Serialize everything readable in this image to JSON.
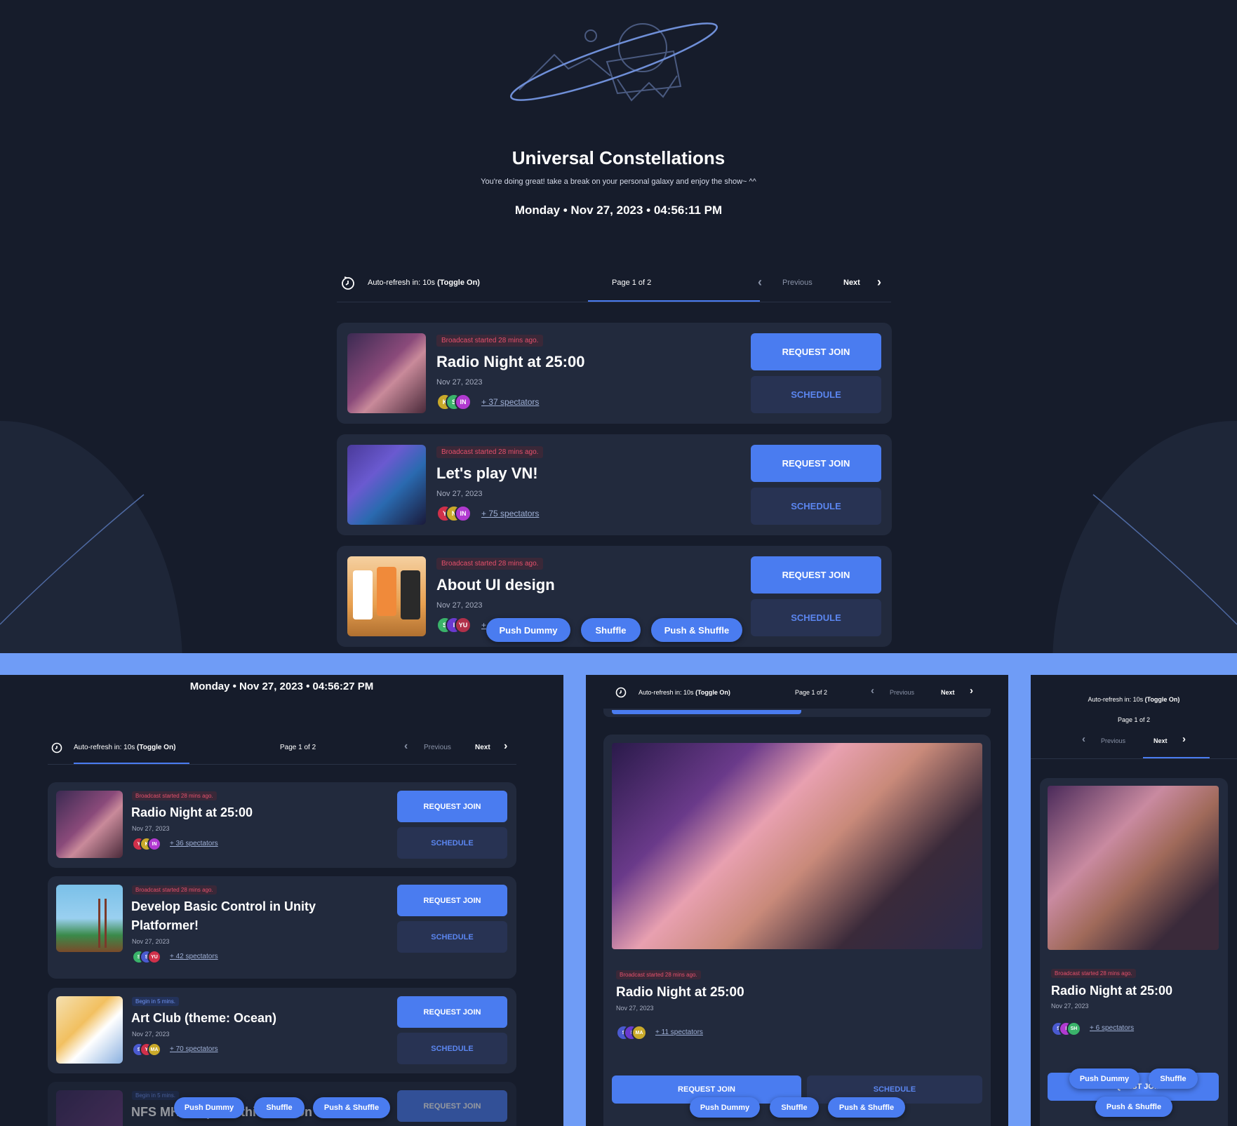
{
  "app": {
    "title": "Universal Constellations",
    "subtitle": "You're doing great! take a break on your personal galaxy and enjoy the show~ ^^",
    "datetime_main": "Monday • Nov 27, 2023 • 04:56:11 PM",
    "datetime_left": "Monday • Nov 27, 2023 • 04:56:27 PM"
  },
  "toolbar": {
    "auto_refresh": "Auto-refresh in: 10s",
    "toggle": "(Toggle On)",
    "page": "Page 1 of 2",
    "previous": "Previous",
    "next": "Next"
  },
  "buttons": {
    "request_join": "REQUEST JOIN",
    "schedule": "SCHEDULE",
    "push_dummy": "Push Dummy",
    "shuffle": "Shuffle",
    "push_shuffle": "Push & Shuffle"
  },
  "main_cards": [
    {
      "badge": "Broadcast started 28 mins ago.",
      "title": "Radio Night at 25:00",
      "date": "Nov 27, 2023",
      "spectators": "+ 37 spectators",
      "avatars": [
        "K",
        "S",
        "IN"
      ]
    },
    {
      "badge": "Broadcast started 28 mins ago.",
      "title": "Let's play VN!",
      "date": "Nov 27, 2023",
      "spectators": "+ 75 spectators",
      "avatars": [
        "Y",
        "N",
        "IN"
      ]
    },
    {
      "badge": "Broadcast started 28 mins ago.",
      "title": "About UI design",
      "date": "Nov 27, 2023",
      "spectators": "+",
      "avatars": [
        "S",
        "I",
        "YU"
      ]
    }
  ],
  "left_cards": [
    {
      "badge": "Broadcast started 28 mins ago.",
      "title": "Radio Night at 25:00",
      "date": "Nov 27, 2023",
      "spectators": "+ 36 spectators",
      "avatars": [
        "Y",
        "K",
        "IN"
      ]
    },
    {
      "badge": "Broadcast started 28 mins ago.",
      "title": "Develop Basic Control in Unity",
      "title2": "Platformer!",
      "date": "Nov 27, 2023",
      "spectators": "+ 42 spectators",
      "avatars": [
        "S",
        "S",
        "YU"
      ]
    },
    {
      "badge": "Begin in 5 mins.",
      "title": "Art Club (theme: Ocean)",
      "date": "Nov 27, 2023",
      "spectators": "+ 70 spectators",
      "avatars": [
        "S",
        "Y",
        "MA"
      ]
    },
    {
      "badge": "Begin in 5 mins.",
      "title": "NFS MH - Explore this horizon"
    }
  ],
  "mid_card": {
    "badge": "Broadcast started 28 mins ago.",
    "title": "Radio Night at 25:00",
    "date": "Nov 27, 2023",
    "spectators": "+ 11 spectators",
    "avatars": [
      "S",
      "I",
      "MA"
    ]
  },
  "right_card": {
    "badge": "Broadcast started 28 mins ago.",
    "title": "Radio Night at 25:00",
    "date": "Nov 27, 2023",
    "spectators": "+ 6 spectators",
    "avatars": [
      "S",
      "I",
      "SH"
    ]
  },
  "colors": {
    "accent": "#4a7cf0",
    "background": "#161c2b",
    "card": "#222a3d",
    "divider_band": "#6f9cf6"
  }
}
